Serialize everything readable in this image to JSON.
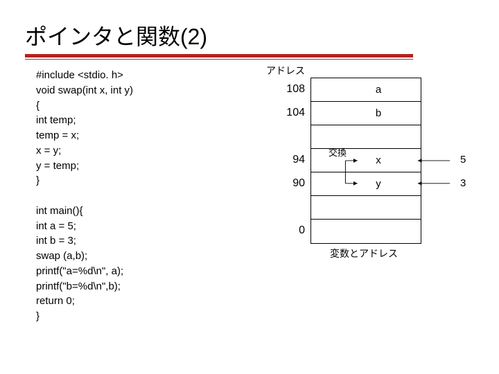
{
  "title": "ポインタと関数(2)",
  "code": "#include <stdio. h>\nvoid swap(int x, int y)\n{\nint temp;\ntemp = x;\nx = y;\ny = temp;\n}\n\nint main(){\nint a = 5;\nint b = 3;\nswap (a,b);\nprintf(\"a=%d\\n\", a);\nprintf(\"b=%d\\n\",b);\nreturn 0;\n}",
  "diagram": {
    "address_header": "アドレス",
    "rows": {
      "r0": {
        "addr": "108",
        "val": "a"
      },
      "r1": {
        "addr": "104",
        "val": "b"
      },
      "r2": {
        "addr": "",
        "val": ""
      },
      "r3": {
        "addr": "94",
        "val": "x"
      },
      "r4": {
        "addr": "90",
        "val": "y"
      },
      "r5": {
        "addr": "",
        "val": ""
      },
      "r6": {
        "addr": "0",
        "val": ""
      }
    },
    "swap_label": "交換",
    "ext_x": "5",
    "ext_y": "3",
    "caption": "変数とアドレス"
  }
}
